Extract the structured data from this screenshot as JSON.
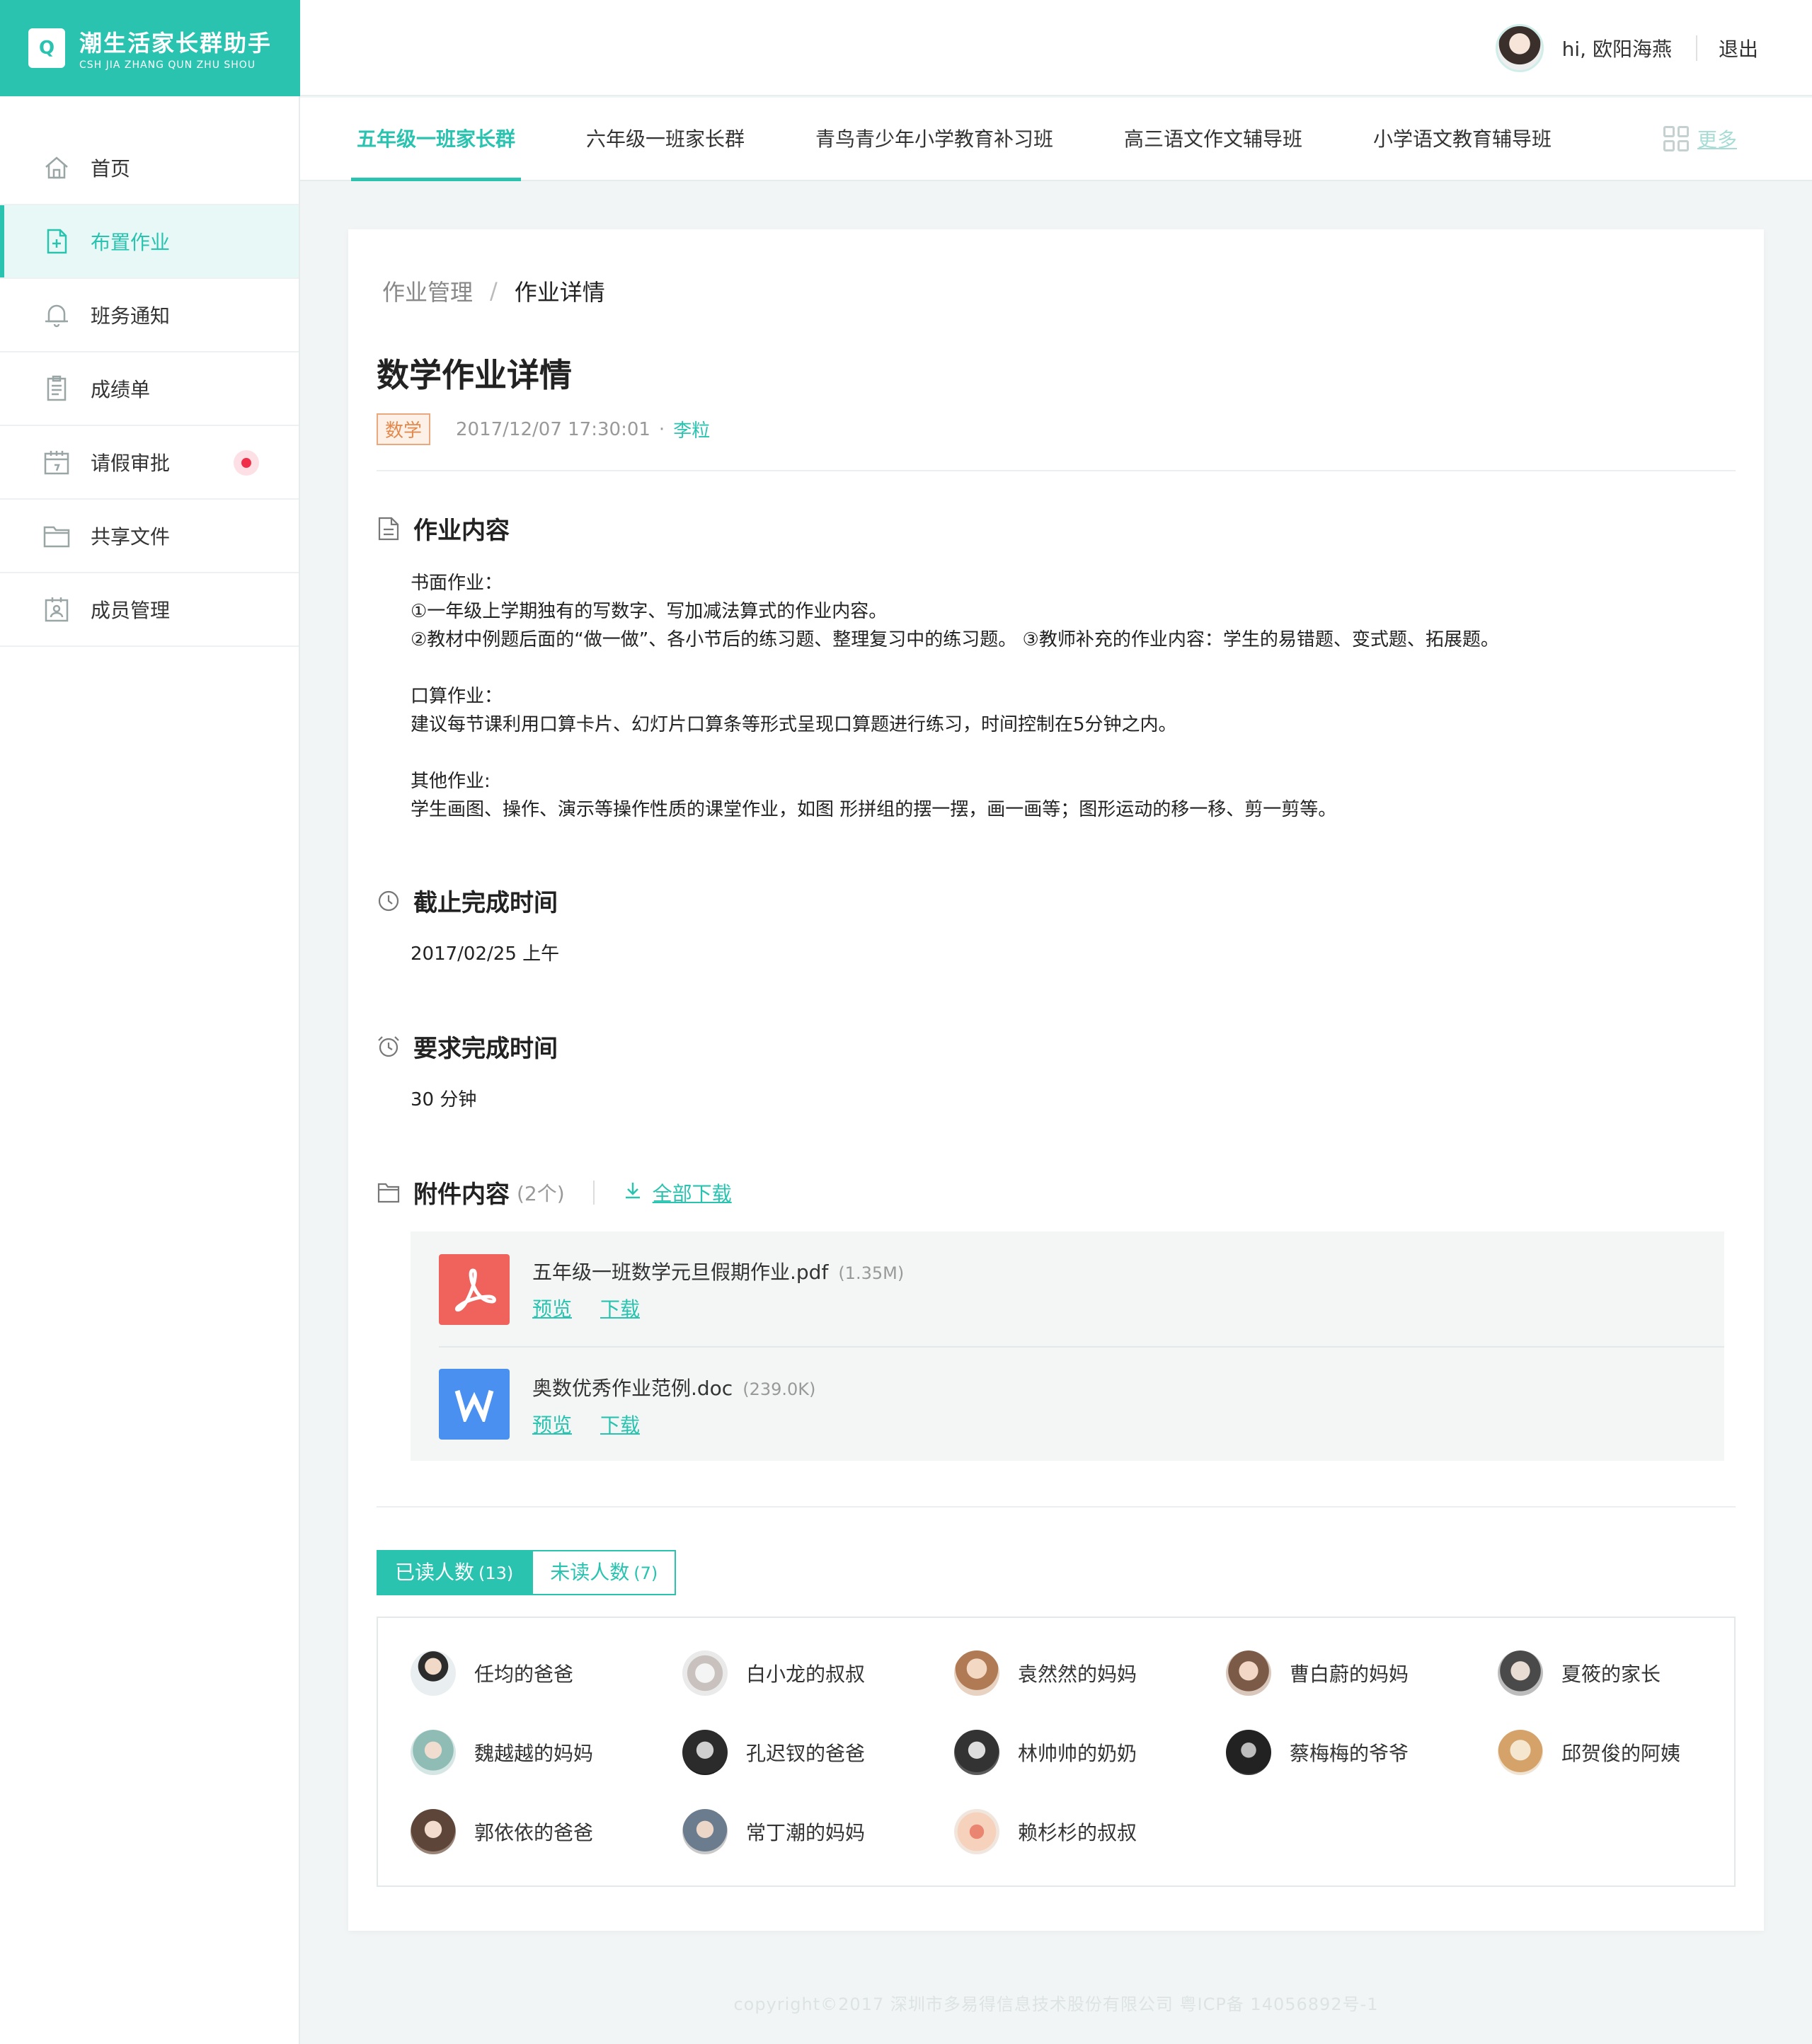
{
  "app": {
    "logo_mark": "Q",
    "name_cn": "潮生活家长群助手",
    "name_en": "CSH JIA ZHANG QUN ZHU SHOU"
  },
  "sidebar": {
    "items": [
      {
        "label": "首页",
        "icon": "home-icon"
      },
      {
        "label": "布置作业",
        "icon": "add-document-icon",
        "active": true
      },
      {
        "label": "班务通知",
        "icon": "bell-icon"
      },
      {
        "label": "成绩单",
        "icon": "clipboard-icon"
      },
      {
        "label": "请假审批",
        "icon": "calendar-icon",
        "badge": true
      },
      {
        "label": "共享文件",
        "icon": "folder-icon"
      },
      {
        "label": "成员管理",
        "icon": "member-card-icon"
      }
    ]
  },
  "header": {
    "greeting": "hi, 欧阳海燕",
    "logout": "退出"
  },
  "tabs": {
    "items": [
      "五年级一班家长群",
      "六年级一班家长群",
      "青鸟青少年小学教育补习班",
      "高三语文作文辅导班",
      "小学语文教育辅导班"
    ],
    "active_index": 0,
    "more": "更多"
  },
  "breadcrumb": {
    "parent": "作业管理",
    "separator": "/",
    "current": "作业详情"
  },
  "detail": {
    "title": "数学作业详情",
    "tag": "数学",
    "time": "2017/12/07 17:30:01",
    "dot": "·",
    "author": "李粒"
  },
  "content_section": {
    "title": "作业内容",
    "lines_a": [
      "书面作业：",
      "①一年级上学期独有的写数字、写加减法算式的作业内容。",
      "②教材中例题后面的“做一做”、各小节后的练习题、整理复习中的练习题。 ③教师补充的作业内容：学生的易错题、变式题、拓展题。"
    ],
    "lines_b": [
      "口算作业：",
      "建议每节课利用口算卡片、幻灯片口算条等形式呈现口算题进行练习，时间控制在5分钟之内。"
    ],
    "lines_c": [
      "其他作业:",
      "学生画图、操作、演示等操作性质的课堂作业，如图 形拼组的摆一摆，画一画等；图形运动的移一移、剪一剪等。"
    ]
  },
  "deadline": {
    "title": "截止完成时间",
    "value": "2017/02/25 上午"
  },
  "duration": {
    "title": "要求完成时间",
    "value": "30 分钟"
  },
  "attachments": {
    "title": "附件内容",
    "count": "(2个)",
    "download_all": "全部下载",
    "files": [
      {
        "name": "五年级一班数学元旦假期作业.pdf",
        "size": "(1.35M)",
        "type": "pdf-file-icon",
        "color": "#f0625c",
        "preview": "预览",
        "download": "下载"
      },
      {
        "name": "奥数优秀作业范例.doc",
        "size": "(239.0K)",
        "type": "word-file-icon",
        "color": "#4a90f0",
        "preview": "预览",
        "download": "下载"
      }
    ]
  },
  "read_status": {
    "read_label": "已读人数",
    "read_count": "(13)",
    "unread_label": "未读人数",
    "unread_count": "(7)",
    "members": [
      "任均的爸爸",
      "白小龙的叔叔",
      "袁然然的妈妈",
      "曹白蔚的妈妈",
      "夏筱的家长",
      "魏越越的妈妈",
      "孔迟钗的爸爸",
      "林帅帅的奶奶",
      "蔡梅梅的爷爷",
      "邱贺俊的阿姨",
      "郭依依的爸爸",
      "常丁潮的妈妈",
      "赖杉杉的叔叔"
    ]
  },
  "footer": {
    "text": "copyright©2017 深圳市多易得信息技术股份有限公司    粤ICP备 14056892号-1"
  },
  "colors": {
    "accent": "#29c3b0",
    "tag_orange": "#e28a4e",
    "badge_red": "#f0304a"
  }
}
